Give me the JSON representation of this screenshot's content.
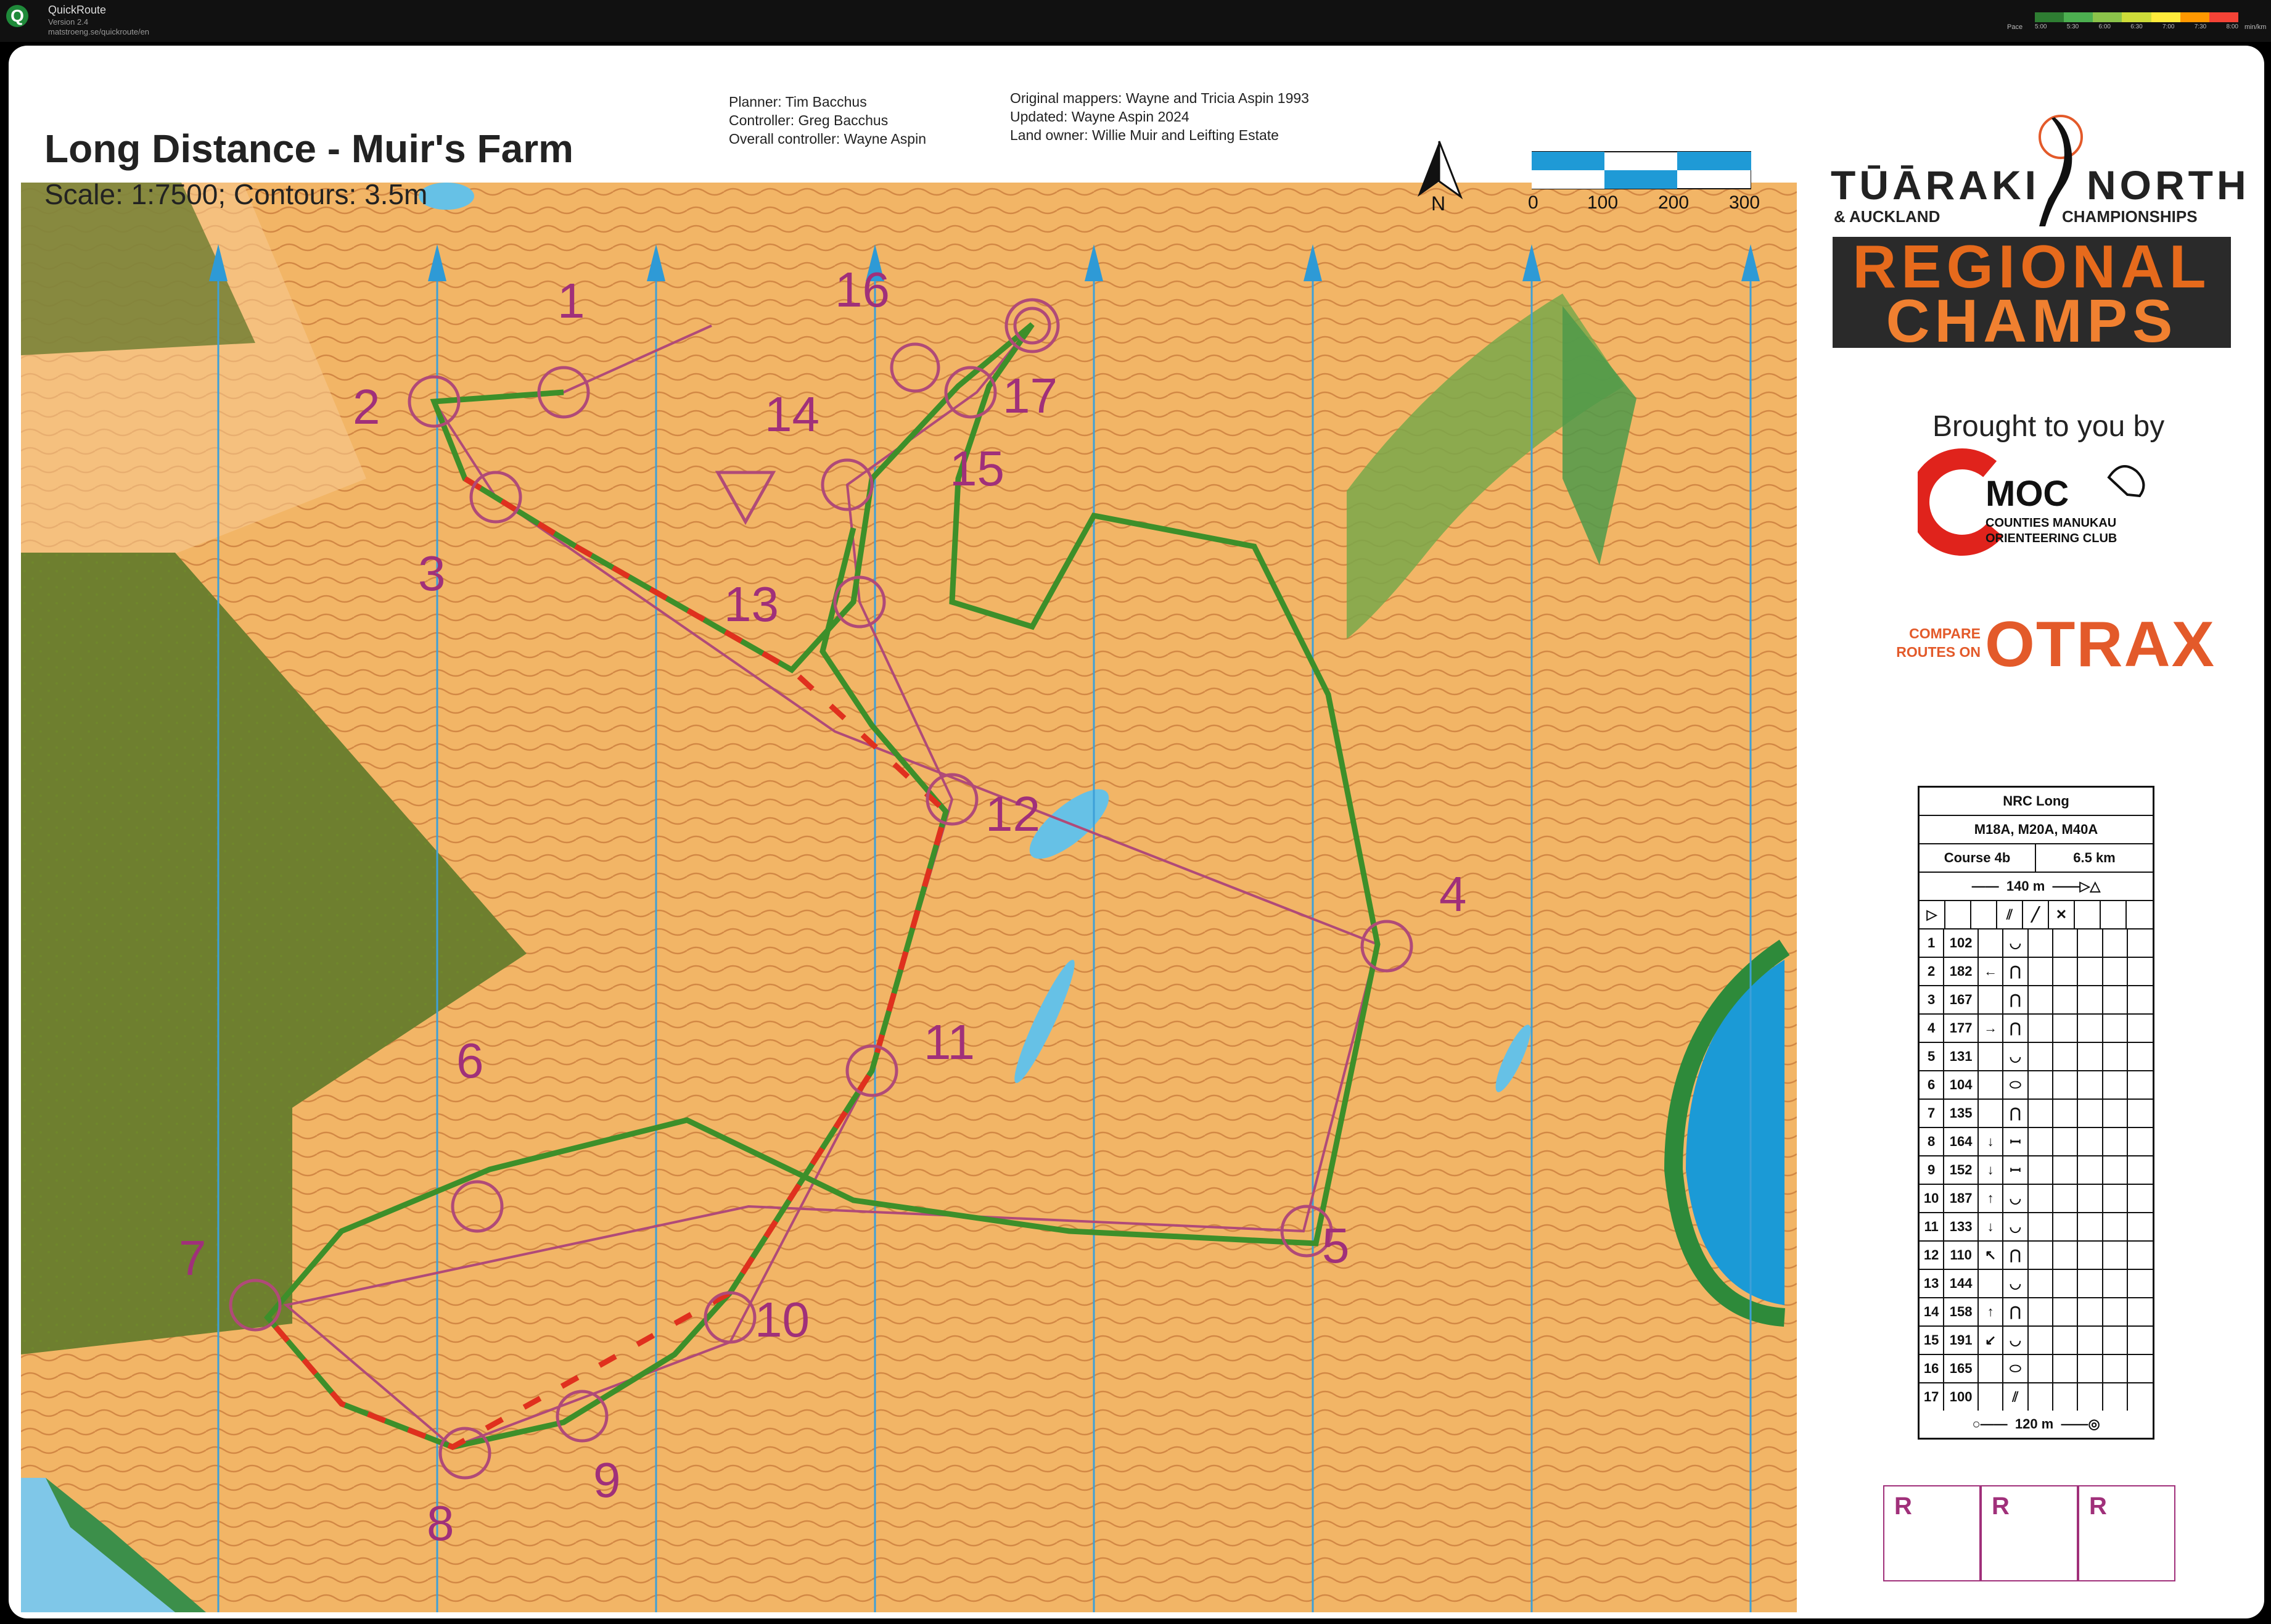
{
  "window": {
    "app_name": "QuickRoute",
    "version": "Version 2.4",
    "url": "matstroeng.se/quickroute/en",
    "pace_label": "Pace",
    "pace_ticks": [
      "5:00",
      "5:30",
      "6:00",
      "6:30",
      "7:00",
      "7:30",
      "8:00"
    ],
    "pace_unit": "min/km",
    "pace_colors": [
      "#2e7d32",
      "#4caf50",
      "#8bc34a",
      "#cddc39",
      "#ffeb3b",
      "#ff9800",
      "#f44336"
    ]
  },
  "header": {
    "title": "Long Distance - Muir's Farm",
    "scale": "Scale: 1:7500; Contours: 3.5m",
    "staff": [
      "Planner: Tim Bacchus",
      "Controller: Greg Bacchus",
      "Overall controller: Wayne Aspin"
    ],
    "mapping": [
      "Original mappers: Wayne and Tricia Aspin 1993",
      "Updated: Wayne Aspin 2024",
      "Land owner: Willie Muir and Leifting Estate"
    ],
    "north_label": "N",
    "scalebar_labels": [
      "0",
      "100",
      "200",
      "300"
    ]
  },
  "branding": {
    "line1_left": "TŪĀRAKI",
    "line1_right": "NORTH",
    "line2_left": "& AUCKLAND",
    "line2_right": "CHAMPIONSHIPS",
    "regional_1": "REGIONAL",
    "regional_2": "CHAMPS",
    "brought": "Brought to you by",
    "club_short": "MOC",
    "club_line1": "COUNTIES MANUKAU",
    "club_line2": "ORIENTEERING CLUB",
    "compare_1": "COMPARE",
    "compare_2": "ROUTES ON",
    "otrax": "OTRAX"
  },
  "control_description": {
    "event": "NRC Long",
    "classes": "M18A, M20A, M40A",
    "course": "Course 4b",
    "length": "6.5 km",
    "start_distance": "140 m",
    "finish_distance": "120 m",
    "controls": [
      {
        "n": "1",
        "code": "102",
        "dir": "",
        "feature": "◡"
      },
      {
        "n": "2",
        "code": "182",
        "dir": "←",
        "feature": "⋂"
      },
      {
        "n": "3",
        "code": "167",
        "dir": "",
        "feature": "⋂"
      },
      {
        "n": "4",
        "code": "177",
        "dir": "→",
        "feature": "⋂"
      },
      {
        "n": "5",
        "code": "131",
        "dir": "",
        "feature": "◡"
      },
      {
        "n": "6",
        "code": "104",
        "dir": "",
        "feature": "⬭"
      },
      {
        "n": "7",
        "code": "135",
        "dir": "",
        "feature": "⋂"
      },
      {
        "n": "8",
        "code": "164",
        "dir": "↓",
        "feature": "ꟷ"
      },
      {
        "n": "9",
        "code": "152",
        "dir": "↓",
        "feature": "ꟷ"
      },
      {
        "n": "10",
        "code": "187",
        "dir": "↑",
        "feature": "◡"
      },
      {
        "n": "11",
        "code": "133",
        "dir": "↓",
        "feature": "◡"
      },
      {
        "n": "12",
        "code": "110",
        "dir": "↖",
        "feature": "⋂"
      },
      {
        "n": "13",
        "code": "144",
        "dir": "",
        "feature": "◡"
      },
      {
        "n": "14",
        "code": "158",
        "dir": "↑",
        "feature": "⋂"
      },
      {
        "n": "15",
        "code": "191",
        "dir": "↙",
        "feature": "◡"
      },
      {
        "n": "16",
        "code": "165",
        "dir": "",
        "feature": "⬭"
      },
      {
        "n": "17",
        "code": "100",
        "dir": "",
        "feature": "⫽"
      }
    ]
  },
  "controls_on_map": [
    "1",
    "2",
    "3",
    "4",
    "5",
    "6",
    "7",
    "8",
    "9",
    "10",
    "11",
    "12",
    "13",
    "14",
    "15",
    "16",
    "17"
  ],
  "r_boxes": [
    "R",
    "R",
    "R"
  ]
}
